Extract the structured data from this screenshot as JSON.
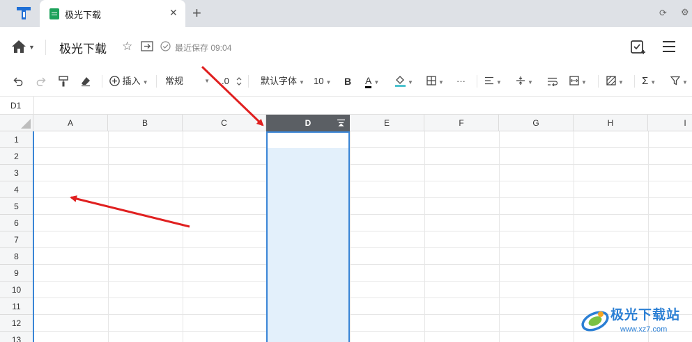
{
  "browser": {
    "tab_title": "极光下载",
    "tab_close": "✕",
    "new_tab": "+",
    "refresh_icon": "⟳",
    "settings_icon": "⚙"
  },
  "header": {
    "doc_title": "极光下载",
    "save_status": "最近保存 09:04",
    "star_icon": "☆"
  },
  "toolbar": {
    "insert_label": "插入",
    "number_format": "常规",
    "decimal_label": ".0",
    "font_name": "默认字体",
    "font_size": "10",
    "bold_label": "B",
    "font_color_label": "A",
    "more_label": "···",
    "colors": {
      "font_color": "#000000",
      "fill_color": "#4cc3cf"
    }
  },
  "formula_bar": {
    "cell_ref": "D1"
  },
  "grid": {
    "columns": [
      "A",
      "B",
      "C",
      "D",
      "E",
      "F",
      "G",
      "H",
      "I"
    ],
    "selected_column": "D",
    "rows": [
      "1",
      "2",
      "3",
      "4",
      "5",
      "6",
      "7",
      "8",
      "9",
      "10",
      "11",
      "12",
      "13"
    ]
  },
  "watermark": {
    "name": "极光下载站",
    "url": "www.xz7.com"
  },
  "theme": {
    "selection": "#3a85d6",
    "selection_fill": "#e3f0fb",
    "arrow": "#e02020",
    "brand": "#2b7fd4"
  }
}
